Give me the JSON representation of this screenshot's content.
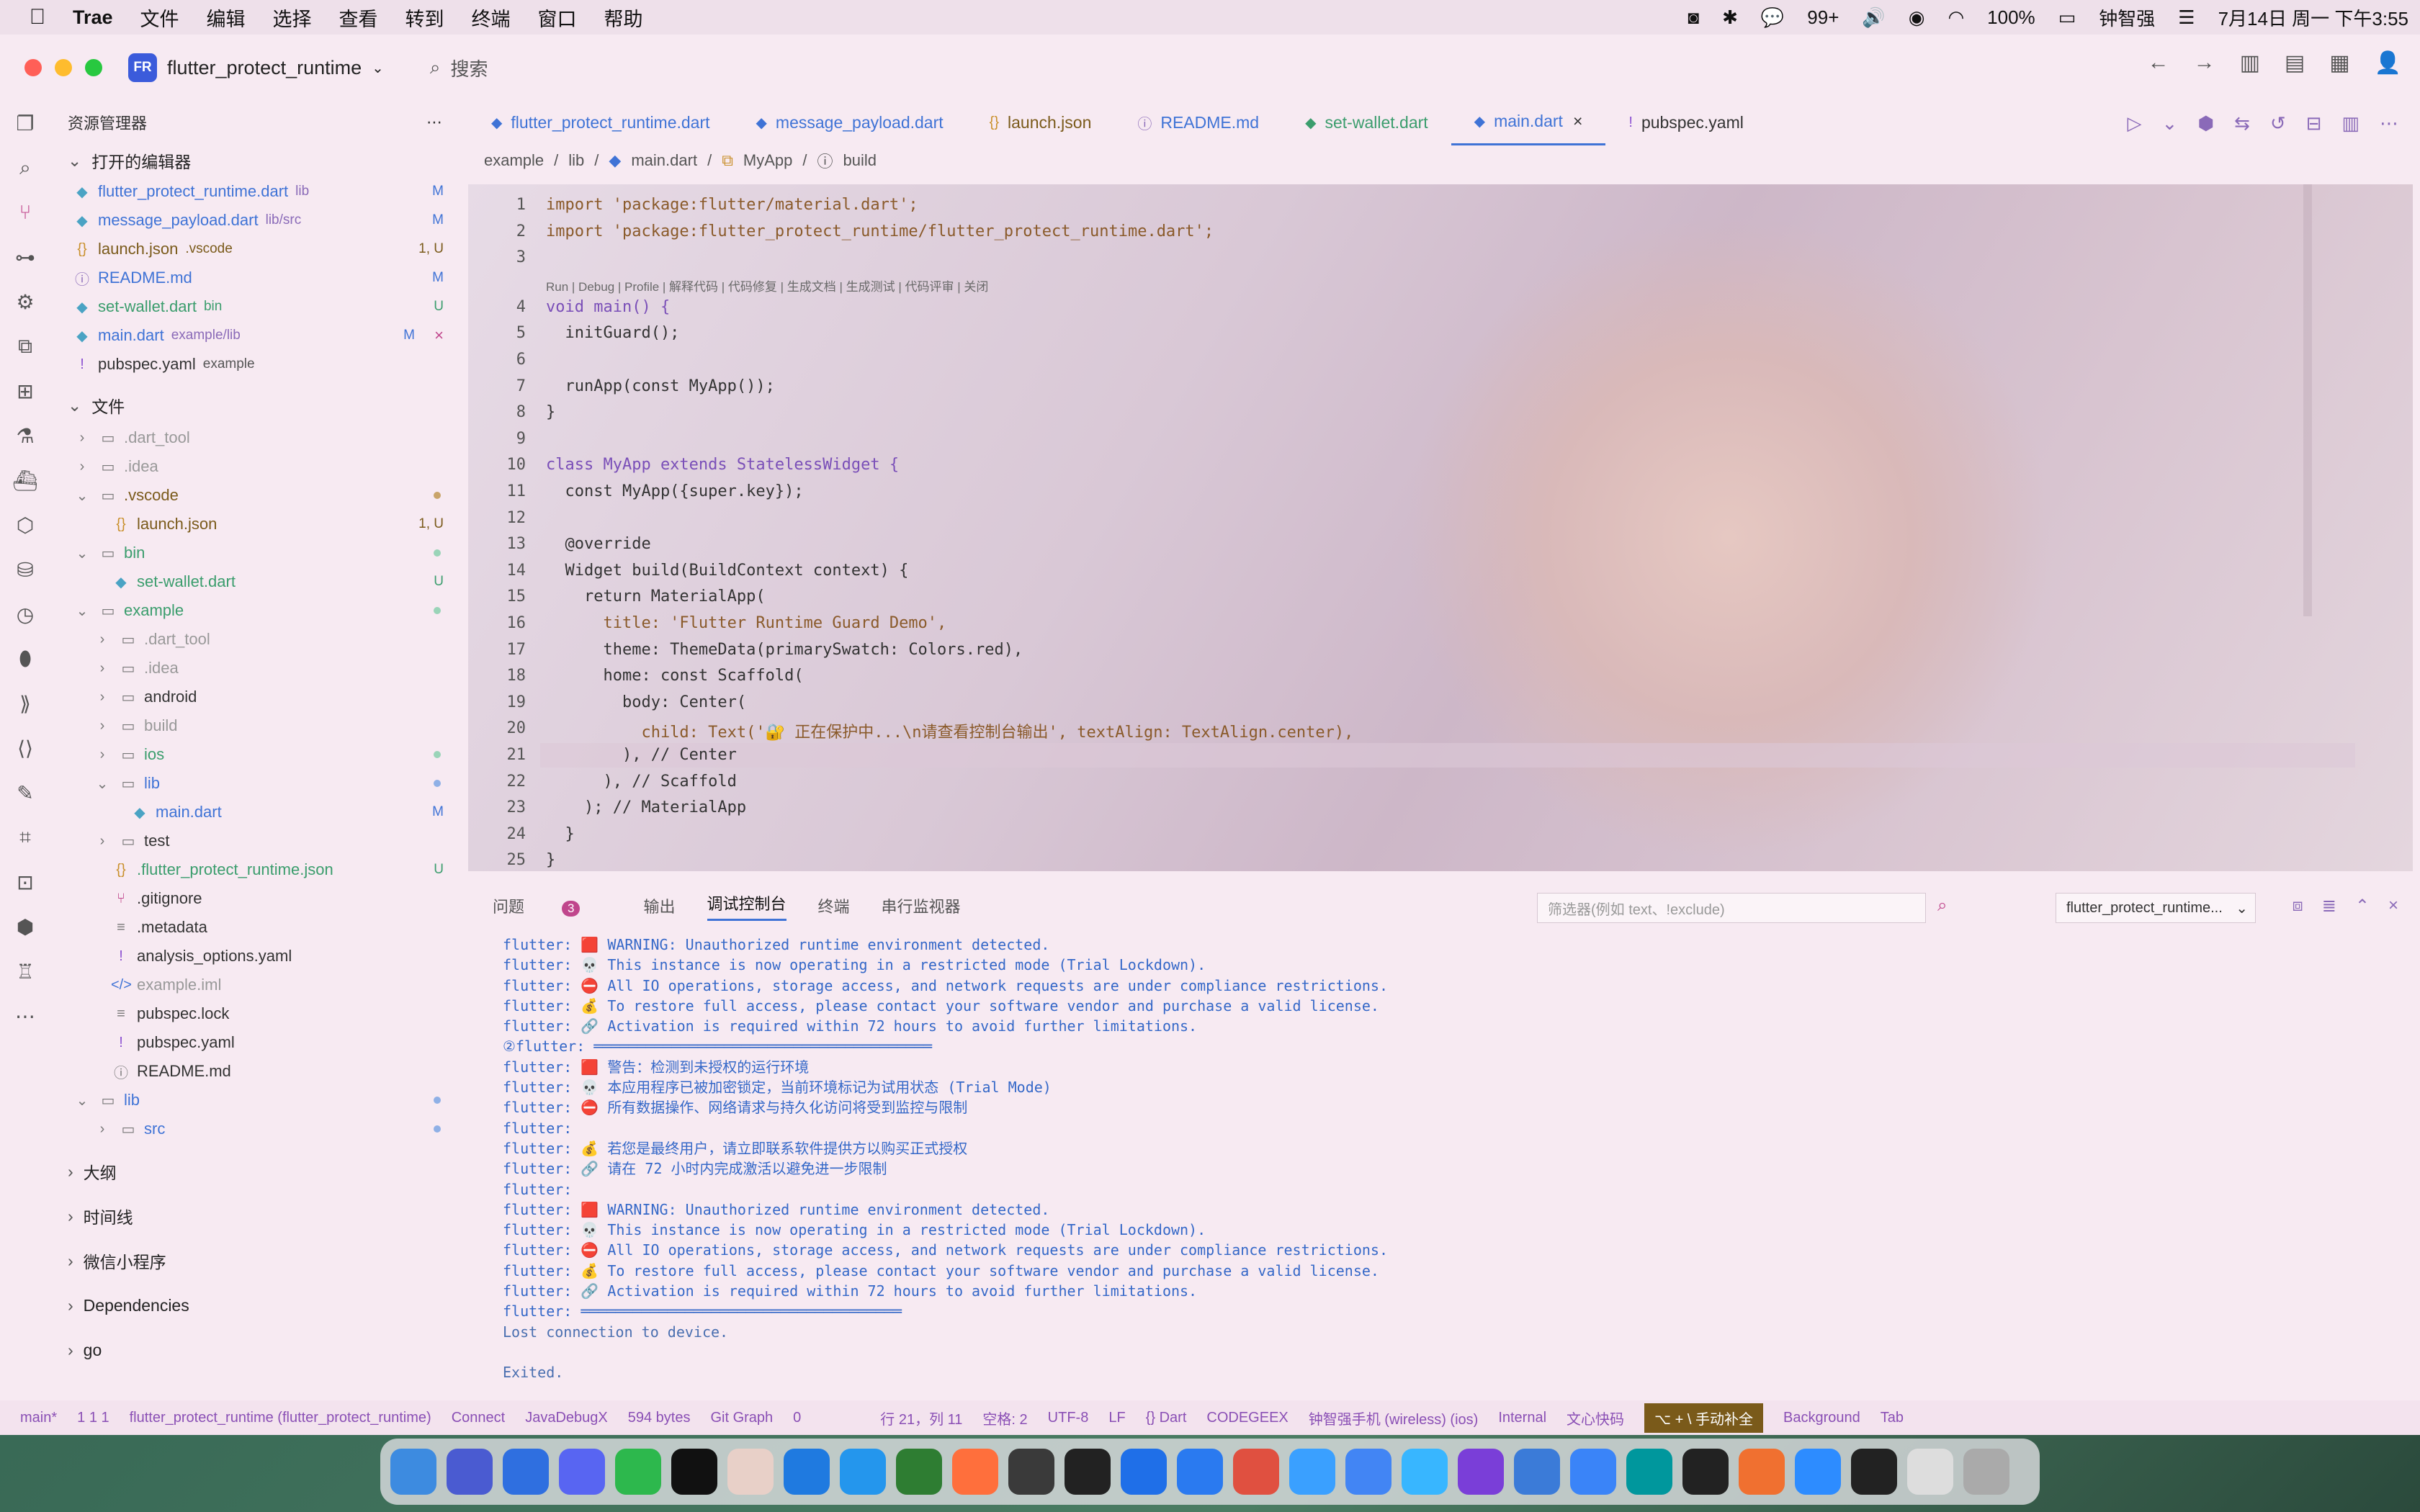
{
  "menubar": {
    "app": "Trae",
    "items": [
      "文件",
      "编辑",
      "选择",
      "查看",
      "转到",
      "终端",
      "窗口",
      "帮助"
    ],
    "status_items": [
      "99+",
      "100%",
      "钟智强",
      "7月14日 周一 下午3:55"
    ]
  },
  "titlebar": {
    "project_badge": "FR",
    "project": "flutter_protect_runtime",
    "search": "搜索"
  },
  "sidebar": {
    "title": "资源管理器",
    "open_editors_title": "打开的编辑器",
    "open_editors": [
      {
        "name": "flutter_protect_runtime.dart",
        "sub": "lib",
        "status": "M"
      },
      {
        "name": "message_payload.dart",
        "sub": "lib/src",
        "status": "M"
      },
      {
        "name": "launch.json",
        "sub": ".vscode",
        "status": "1, U"
      },
      {
        "name": "README.md",
        "sub": "",
        "status": "M"
      },
      {
        "name": "set-wallet.dart",
        "sub": "bin",
        "status": "U"
      },
      {
        "name": "main.dart",
        "sub": "example/lib",
        "status": "M"
      },
      {
        "name": "pubspec.yaml",
        "sub": "example",
        "status": ""
      }
    ],
    "files_title": "文件",
    "tree": [
      ".dart_tool",
      ".idea",
      ".vscode",
      "launch.json",
      "bin",
      "set-wallet.dart",
      "example",
      ".dart_tool",
      ".idea",
      "android",
      "build",
      "ios",
      "lib",
      "main.dart",
      "test",
      ".flutter_protect_runtime.json",
      ".gitignore",
      ".metadata",
      "analysis_options.yaml",
      "example.iml",
      "pubspec.lock",
      "pubspec.yaml",
      "README.md",
      "lib",
      "src"
    ],
    "tree_status": {
      "launch": "1, U",
      "setwallet": "U",
      "maindart": "M",
      "fprj": "U"
    },
    "sections": [
      "大纲",
      "时间线",
      "微信小程序",
      "Dependencies",
      "go"
    ]
  },
  "tabs": [
    {
      "label": "flutter_protect_runtime.dart",
      "icon": "dart-icon"
    },
    {
      "label": "message_payload.dart",
      "icon": "dart-icon"
    },
    {
      "label": "launch.json",
      "icon": "json-icon"
    },
    {
      "label": "README.md",
      "icon": "info-icon"
    },
    {
      "label": "set-wallet.dart",
      "icon": "dart-icon"
    },
    {
      "label": "main.dart",
      "icon": "dart-icon"
    },
    {
      "label": "pubspec.yaml",
      "icon": "yaml-icon"
    }
  ],
  "breadcrumb": [
    "example",
    "lib",
    "main.dart",
    "MyApp",
    "build"
  ],
  "code": {
    "line_numbers": [
      "1",
      "2",
      "3",
      "4",
      "5",
      "6",
      "7",
      "8",
      "9",
      "10",
      "11",
      "12",
      "13",
      "14",
      "15",
      "16",
      "17",
      "18",
      "19",
      "20",
      "21",
      "22",
      "23",
      "24",
      "25"
    ],
    "codelens": "Run | Debug | Profile | 解释代码 | 代码修复 | 生成文档 | 生成测试 | 代码评审 | 关闭",
    "lines": [
      "import 'package:flutter/material.dart';",
      "import 'package:flutter_protect_runtime/flutter_protect_runtime.dart';",
      "",
      "void main() {",
      "  initGuard();",
      "",
      "  runApp(const MyApp());",
      "}",
      "",
      "class MyApp extends StatelessWidget {",
      "  const MyApp({super.key});",
      "",
      "  @override",
      "  Widget build(BuildContext context) {",
      "    return MaterialApp(",
      "      title: 'Flutter Runtime Guard Demo',",
      "      theme: ThemeData(primarySwatch: Colors.red),",
      "      home: const Scaffold(",
      "        body: Center(",
      "          child: Text('🔐 正在保护中...\\n请查看控制台输出', textAlign: TextAlign.center),",
      "        ), // Center",
      "      ), // Scaffold",
      "    ); // MaterialApp",
      "  }",
      "}"
    ]
  },
  "panel": {
    "tabs": [
      "问题",
      "输出",
      "调试控制台",
      "终端",
      "串行监视器"
    ],
    "problem_count": "3",
    "filter_placeholder": "筛选器(例如 text、!exclude)",
    "select": "flutter_protect_runtime...",
    "output": [
      "flutter: 🟥 WARNING: Unauthorized runtime environment detected.",
      "flutter: 💀 This instance is now operating in a restricted mode (Trial Lockdown).",
      "flutter: ⛔ All IO operations, storage access, and network requests are under compliance restrictions.",
      "flutter: 💰 To restore full access, please contact your software vendor and purchase a valid license.",
      "flutter: 🔗 Activation is required within 72 hours to avoid further limitations.",
      "②flutter: ═══════════════════════════════════════",
      "flutter: 🟥 警告：检测到未授权的运行环境",
      "flutter: 💀 本应用程序已被加密锁定，当前环境标记为试用状态 (Trial Mode)",
      "flutter: ⛔ 所有数据操作、网络请求与持久化访问将受到监控与限制",
      "flutter:",
      "flutter: 💰 若您是最终用户，请立即联系软件提供方以购买正式授权",
      "flutter: 🔗 请在 72 小时内完成激活以避免进一步限制",
      "flutter:",
      "flutter: 🟥 WARNING: Unauthorized runtime environment detected.",
      "flutter: 💀 This instance is now operating in a restricted mode (Trial Lockdown).",
      "flutter: ⛔ All IO operations, storage access, and network requests are under compliance restrictions.",
      "flutter: 💰 To restore full access, please contact your software vendor and purchase a valid license.",
      "flutter: 🔗 Activation is required within 72 hours to avoid further limitations.",
      "flutter: ═════════════════════════════════════",
      "Lost connection to device.",
      "",
      "Exited."
    ]
  },
  "statusbar": {
    "items": [
      "main*",
      "1 1 1",
      "flutter_protect_runtime (flutter_protect_runtime)",
      "Connect",
      "JavaDebugX",
      "594 bytes",
      "Git Graph",
      "0",
      "行 21，列 11",
      "空格: 2",
      "UTF-8",
      "LF",
      "{} Dart",
      "CODEGEEX",
      "钟智强手机 (wireless) (ios)",
      "Internal",
      "文心快码",
      "Background",
      "Tab"
    ],
    "highlight": "⌥ + \\ 手动补全"
  },
  "colors": {
    "accent": "#3f73d6",
    "purple": "#8a4fd1"
  }
}
